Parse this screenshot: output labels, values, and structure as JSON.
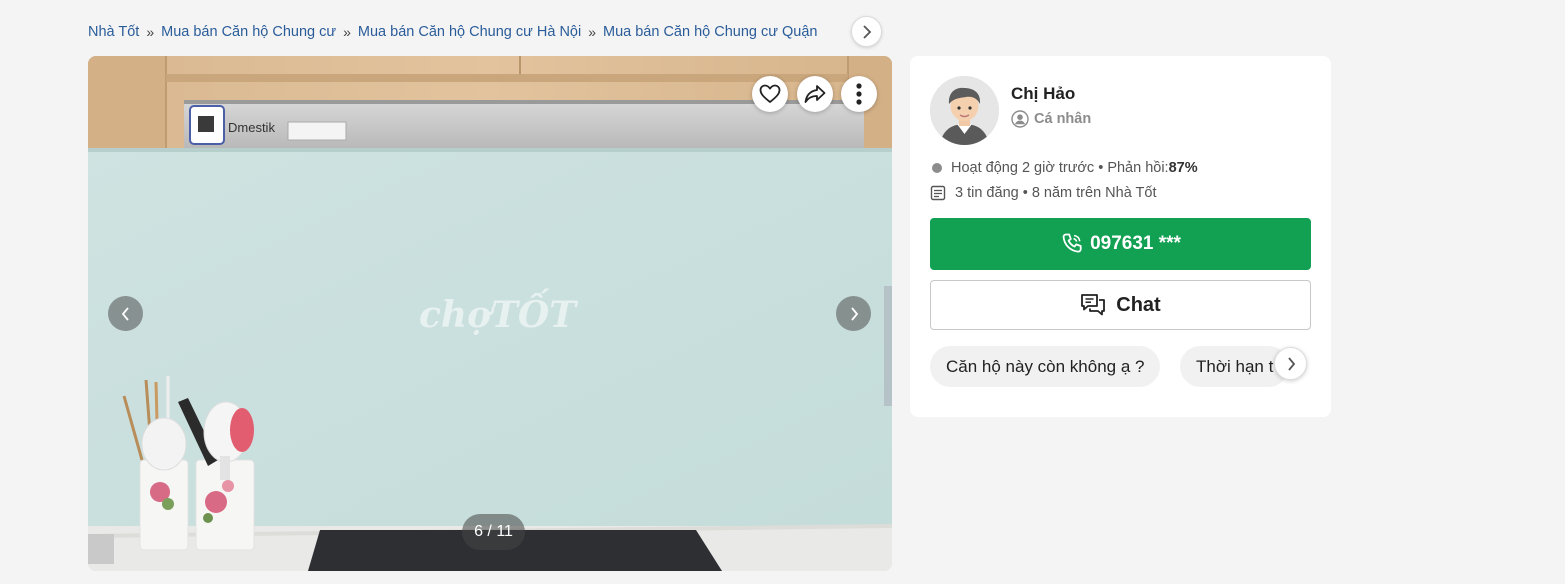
{
  "breadcrumb": {
    "items": [
      "Nhà Tốt",
      "Mua bán Căn hộ Chung cư",
      "Mua bán Căn hộ Chung cư Hà Nội",
      "Mua bán Căn hộ Chung cư Quận"
    ],
    "separator": "»"
  },
  "gallery": {
    "counter": "6 / 11",
    "watermark": "chợTỐT",
    "brand_sticker": "Dmestik"
  },
  "seller": {
    "name": "Chị Hảo",
    "type": "Cá nhân",
    "activity_text": "Hoạt động 2 giờ trước • Phản hồi: ",
    "response_rate": "87%",
    "posts_text": "3 tin đăng • 8 năm trên Nhà Tốt"
  },
  "actions": {
    "phone_label": "097631 ***",
    "chat_label": "Chat"
  },
  "quick_chips": [
    "Căn hộ này còn không ạ ?",
    "Thời hạn t"
  ],
  "colors": {
    "link": "#2a5c9a",
    "phone_button": "#12a152",
    "page_bg": "#f4f4f4"
  }
}
